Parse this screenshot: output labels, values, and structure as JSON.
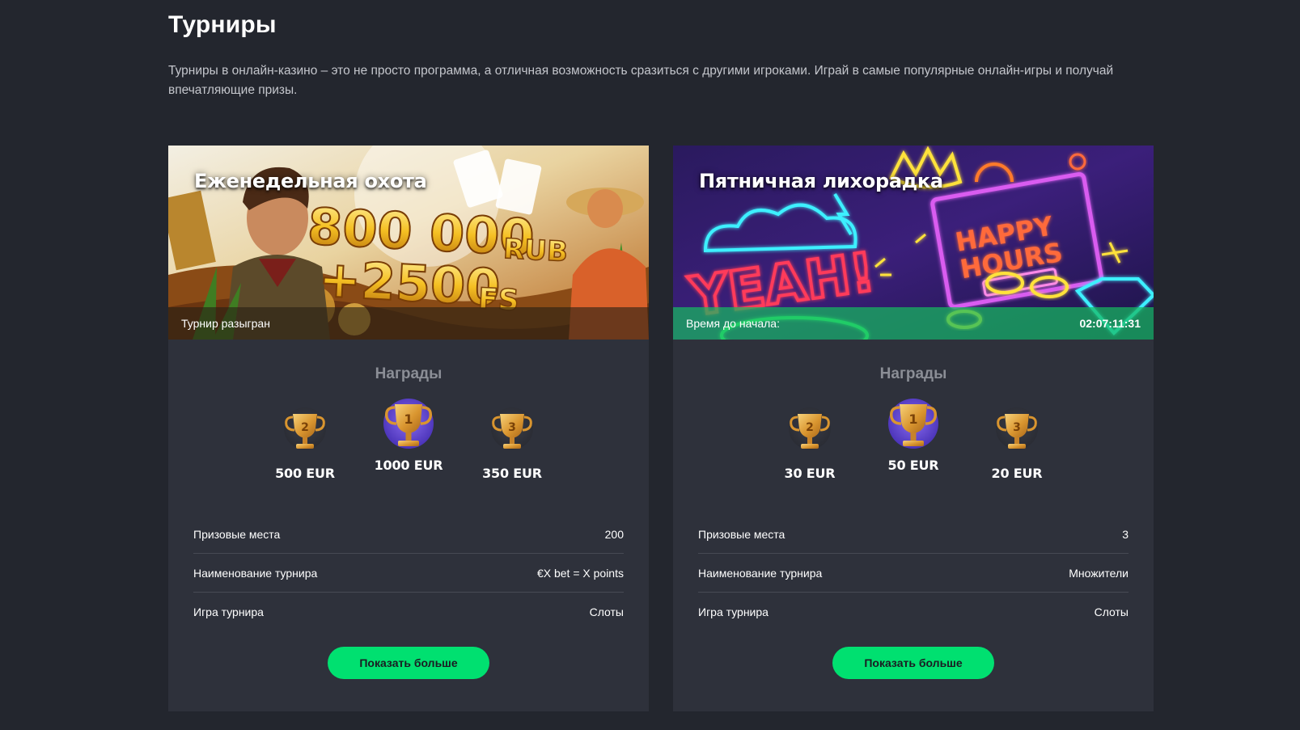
{
  "page": {
    "title": "Турниры",
    "description": "Турниры в онлайн-казино – это не просто программа, а отличная возможность сразиться с другими игроками. Играй в самые популярные онлайн-игры и получай впечатляющие призы."
  },
  "tournaments": [
    {
      "banner_title": "Еженедельная охота",
      "banner_art_text": [
        "800 000",
        "RUB",
        "+2500",
        "FS"
      ],
      "status_text": "Турнир разыгран",
      "timer": "",
      "rewards_title": "Награды",
      "prizes": [
        {
          "place": "2",
          "amount": "500 EUR"
        },
        {
          "place": "1",
          "amount": "1000 EUR"
        },
        {
          "place": "3",
          "amount": "350 EUR"
        }
      ],
      "info": [
        {
          "label": "Призовые места",
          "value": "200"
        },
        {
          "label": "Наименование турнира",
          "value": "€X bet = X points"
        },
        {
          "label": "Игра турнира",
          "value": "Слоты"
        }
      ],
      "button_label": "Показать больше"
    },
    {
      "banner_title": "Пятничная лихорадка",
      "banner_art_text": [
        "YEAH!",
        "HAPPY",
        "HOURS"
      ],
      "status_text": "Время до начала:",
      "timer": "02:07:11:31",
      "rewards_title": "Награды",
      "prizes": [
        {
          "place": "2",
          "amount": "30 EUR"
        },
        {
          "place": "1",
          "amount": "50 EUR"
        },
        {
          "place": "3",
          "amount": "20 EUR"
        }
      ],
      "info": [
        {
          "label": "Призовые места",
          "value": "3"
        },
        {
          "label": "Наименование турнира",
          "value": "Множители"
        },
        {
          "label": "Игра турнира",
          "value": "Слоты"
        }
      ],
      "button_label": "Показать больше"
    }
  ],
  "colors": {
    "background": "#23262e",
    "card": "#2e313b",
    "accent_green": "#00e070",
    "trophy_gold": "#e0a33c",
    "first_place_purple": "#6b4fd8"
  },
  "icons": [
    "trophy-icon"
  ]
}
